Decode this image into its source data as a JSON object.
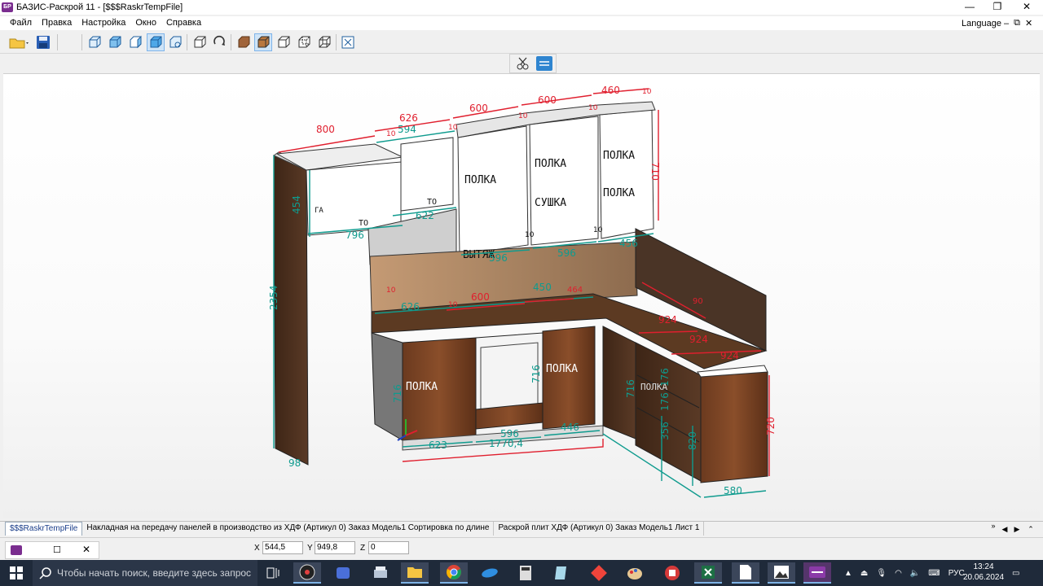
{
  "window": {
    "title": "БАЗИС-Раскрой 11 - [$$$RaskrTempFile]",
    "app_icon_text": "БР",
    "minimize_glyph": "—",
    "maximize_glyph": "❐",
    "close_glyph": "✕"
  },
  "menu": {
    "items": [
      "Файл",
      "Правка",
      "Настройка",
      "Окно",
      "Справка"
    ],
    "language": "Language",
    "mdi_min_glyph": "–",
    "mdi_restore_glyph": "⧉",
    "mdi_close_glyph": "✕"
  },
  "toolbar": {
    "icons": [
      "open-folder-icon",
      "save-icon",
      "view-front-icon",
      "view-top-icon",
      "view-side-icon",
      "view-iso-icon",
      "view-box-icon",
      "rotate-cube-icon",
      "rotate-icon",
      "solid-wood-icon",
      "shaded-box-icon",
      "wireframe-icon",
      "wireframe-hidden-icon",
      "wireframe-all-icon",
      "zoom-fit-icon"
    ]
  },
  "drawing": {
    "labels_green": [
      "594",
      "622",
      "796",
      "454",
      "2354",
      "596",
      "596",
      "456",
      "626",
      "450",
      "716",
      "716",
      "716",
      "623",
      "596",
      "446",
      "176",
      "176",
      "356",
      "820",
      "580",
      "98",
      "1770,4"
    ],
    "labels_red": [
      "800",
      "626",
      "600",
      "600",
      "460",
      "10",
      "10",
      "10",
      "10",
      "10",
      "10",
      "10",
      "710",
      "600",
      "464",
      "924",
      "924",
      "924",
      "720",
      "90",
      "10",
      "10"
    ],
    "panel_texts": [
      "ПОЛКА",
      "ПОЛКА",
      "ПОЛКА",
      "СУШКА",
      "ПОЛКА",
      "ПОЛКА",
      "ПОЛКА",
      "ВЫТЯЖ",
      "ПОЛКА",
      "ТО",
      "ТО",
      "ГА"
    ]
  },
  "tabs": {
    "items": [
      "$$$RaskrTempFile",
      "Накладная на передачу панелей в производство из ХДФ (Артикул 0) Заказ Модель1 Сортировка по длине",
      "Раскрой плит ХДФ (Артикул 0) Заказ Модель1 Лист 1"
    ],
    "nav_menu": "»",
    "nav_prev": "◀",
    "nav_next": "▶",
    "nav_collapse": "⌃"
  },
  "status": {
    "x_label": "X",
    "x_value": "544,5",
    "y_label": "Y",
    "y_value": "949,8",
    "z_label": "Z",
    "z_value": "0"
  },
  "taskbar": {
    "search_placeholder": "Чтобы начать поиск, введите здесь запрос",
    "lang": "РУС",
    "time": "13:24",
    "date": "20.06.2024",
    "apps": [
      "task-view-icon",
      "obs-icon",
      "app-xd-icon",
      "scanner-icon",
      "file-explorer-icon",
      "chrome-icon",
      "edge-icon",
      "calculator-icon",
      "notes-icon",
      "anydesk-icon",
      "paint-icon",
      "app-red-icon",
      "excel-icon",
      "file-icon",
      "photos-icon",
      "bazis-icon"
    ]
  }
}
